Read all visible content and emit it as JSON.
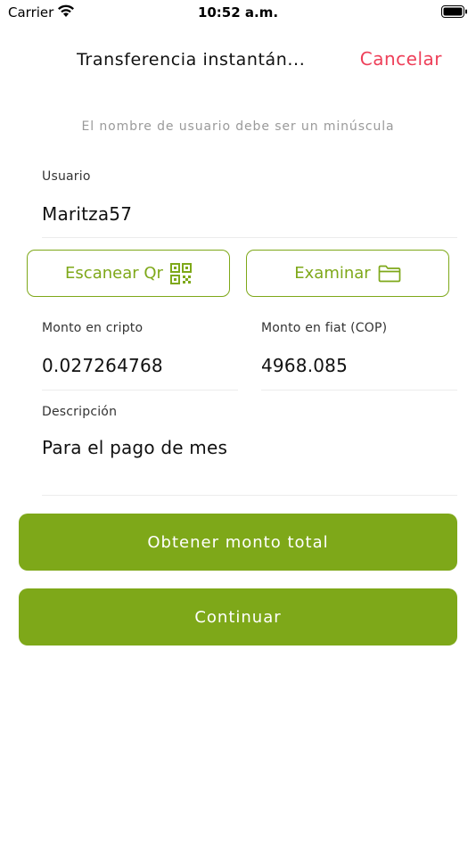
{
  "status_bar": {
    "carrier": "Carrier",
    "time": "10:52 a.m."
  },
  "nav": {
    "title": "Transferencia instantán...",
    "cancel_label": "Cancelar"
  },
  "hint": "El nombre de usuario debe ser un minúscula",
  "user": {
    "label": "Usuario",
    "value": "Maritza57"
  },
  "actions": {
    "scan_label": "Escanear Qr",
    "browse_label": "Examinar"
  },
  "crypto_amount": {
    "label": "Monto en cripto",
    "value": "0.027264768"
  },
  "fiat_amount": {
    "label": "Monto en fiat (COP)",
    "value": "4968.085"
  },
  "description": {
    "label": "Descripción",
    "value": "Para el pago de mes"
  },
  "buttons": {
    "get_total_label": "Obtener monto total",
    "continue_label": "Continuar"
  },
  "colors": {
    "accent": "#7ea819",
    "cancel": "#ee3f59",
    "hint": "#9a9a9a"
  },
  "icons": [
    "wifi-icon",
    "battery-icon",
    "qr-code-icon",
    "folder-icon"
  ]
}
